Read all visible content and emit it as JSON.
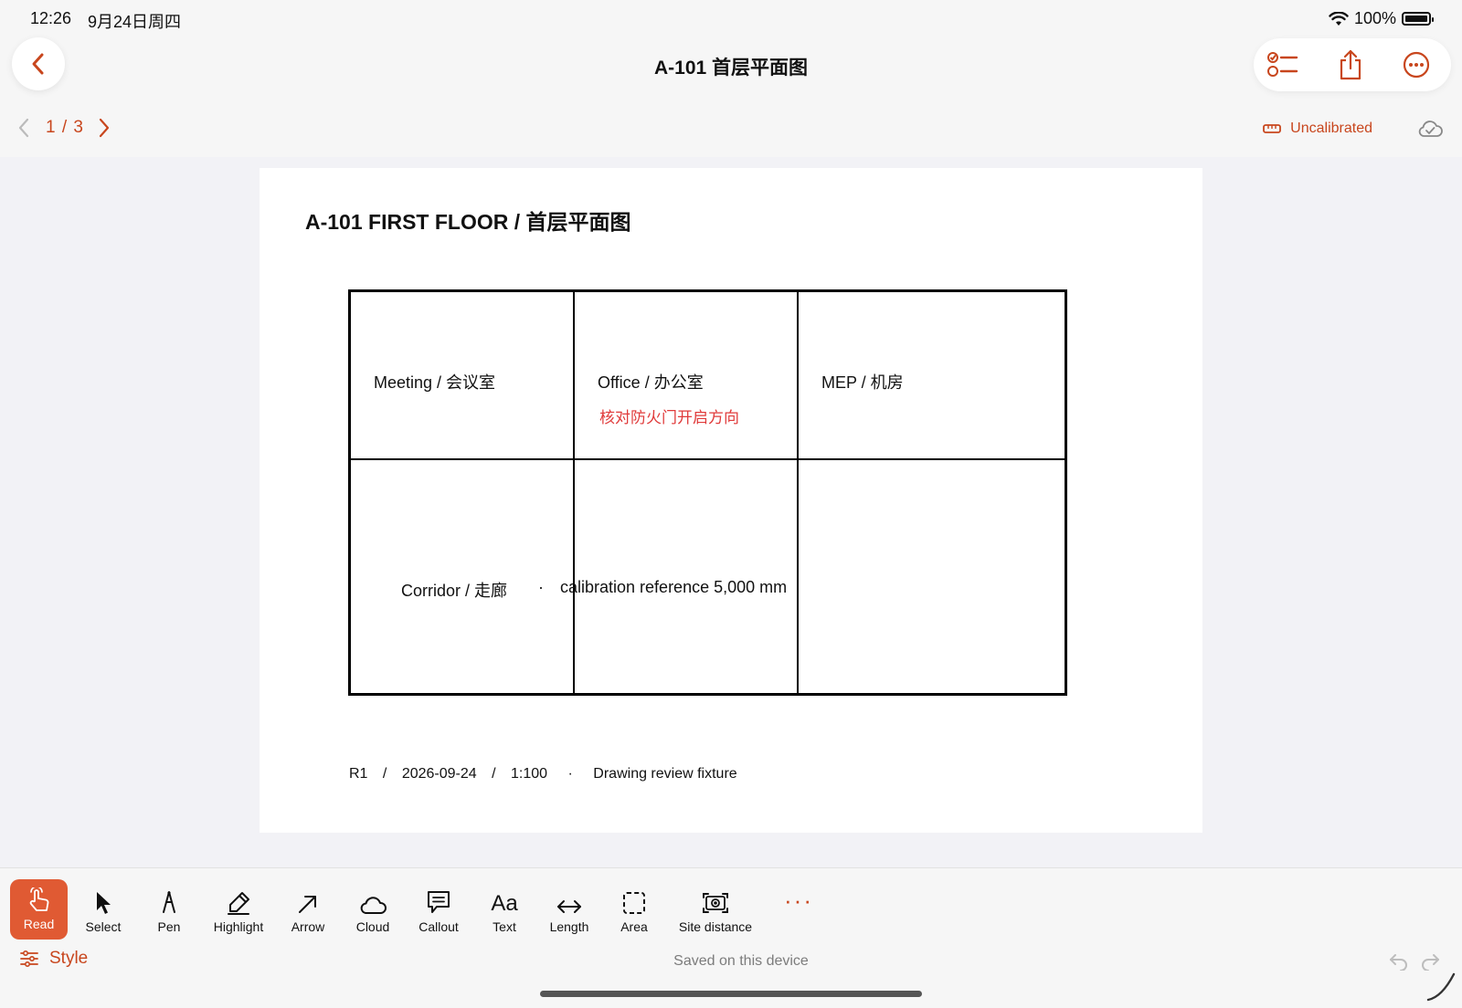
{
  "status_bar": {
    "time": "12:26",
    "date": "9月24日周四",
    "battery": "100%"
  },
  "header": {
    "title": "A-101 首层平面图"
  },
  "page_nav": {
    "current_total": "1 / 3"
  },
  "calibration": {
    "label": "Uncalibrated"
  },
  "sheet": {
    "title": "A-101  FIRST FLOOR / 首层平面图",
    "rooms": {
      "meeting": "Meeting / 会议室",
      "office": "Office / 办公室",
      "mep": "MEP / 机房",
      "corridor": "Corridor / 走廊",
      "calibration_ref": "calibration reference 5,000 mm"
    },
    "separator": "·",
    "annotation": "核对防火门开启方向",
    "footer": {
      "revision": "R1",
      "date": "2026-09-24",
      "scale": "1:100",
      "slash": "/",
      "dot": "·",
      "description": "Drawing review fixture"
    }
  },
  "toolbar": {
    "tools": {
      "read": "Read",
      "select": "Select",
      "pen": "Pen",
      "highlight": "Highlight",
      "arrow": "Arrow",
      "cloud": "Cloud",
      "callout": "Callout",
      "text": "Text",
      "length": "Length",
      "area": "Area",
      "site_distance": "Site distance"
    },
    "text_icon_glyph": "Aa",
    "more": "···",
    "style_label": "Style",
    "saved_status": "Saved on this device"
  },
  "colors": {
    "accent": "#c8461d",
    "read_active": "#e05a33",
    "annotation_red": "#e03a3a"
  }
}
